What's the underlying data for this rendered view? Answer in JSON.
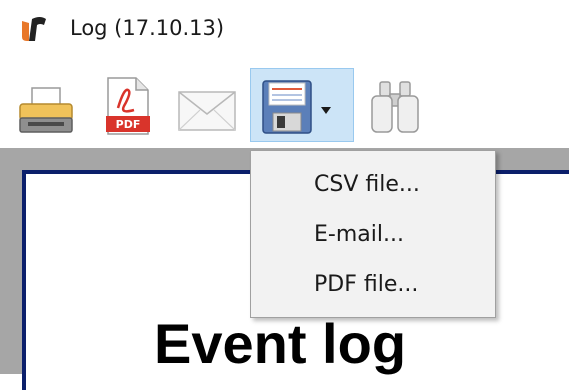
{
  "window": {
    "title": "Log (17.10.13)"
  },
  "toolbar": {
    "buttons": [
      {
        "name": "print",
        "icon": "printer-icon"
      },
      {
        "name": "pdf",
        "icon": "pdf-file-icon",
        "icon_text": "PDF"
      },
      {
        "name": "email",
        "icon": "envelope-icon"
      },
      {
        "name": "save",
        "icon": "floppy-disk-icon",
        "has_dropdown": true,
        "state": "pressed"
      },
      {
        "name": "find",
        "icon": "binoculars-icon"
      }
    ]
  },
  "save_menu": {
    "items": [
      {
        "label": "CSV file..."
      },
      {
        "label": "E-mail..."
      },
      {
        "label": "PDF file..."
      }
    ]
  },
  "report": {
    "title": "Event log"
  },
  "colors": {
    "highlight_bg": "#cce4f7",
    "highlight_border": "#99c9ef",
    "page_border": "#0b1f6b",
    "frame_bg": "#a6a6a6",
    "menu_bg": "#f2f2f2",
    "logo_orange": "#e8782a",
    "pdf_red": "#d9342b"
  }
}
